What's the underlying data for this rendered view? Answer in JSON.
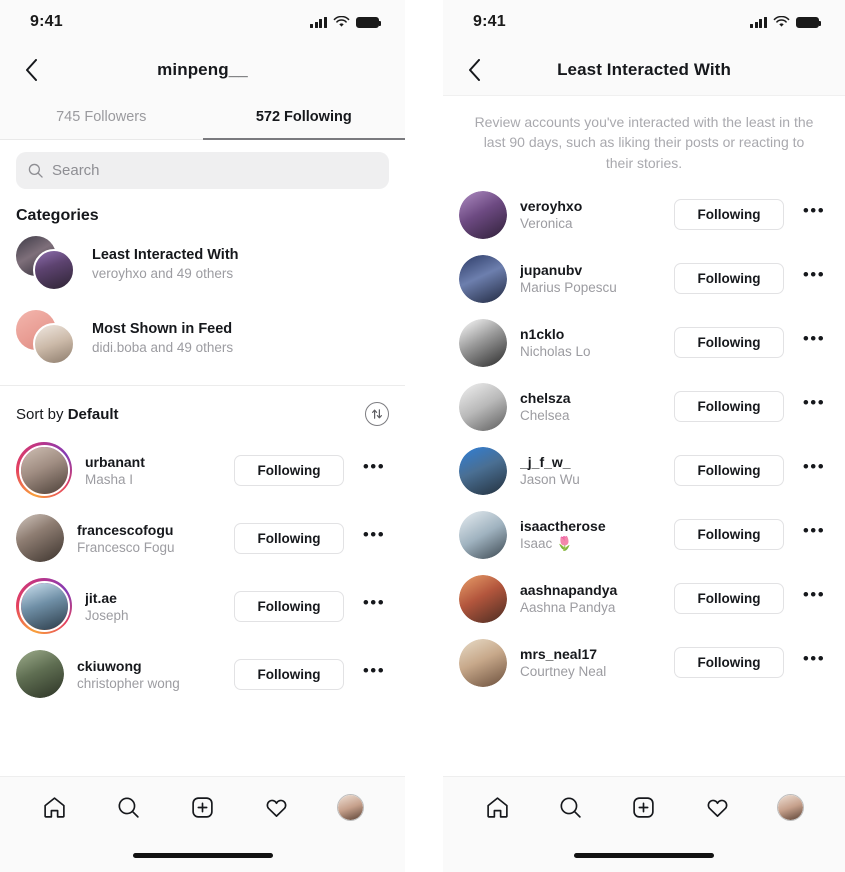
{
  "status_bar": {
    "time": "9:41",
    "signal_icon": "cellular-bars-icon",
    "wifi_icon": "wifi-icon",
    "battery_icon": "battery-full-icon"
  },
  "left_panel": {
    "nav": {
      "back_icon": "chevron-left-icon",
      "title": "minpeng__"
    },
    "tabs": [
      {
        "label": "745 Followers",
        "active": false
      },
      {
        "label": "572 Following",
        "active": true
      }
    ],
    "search": {
      "placeholder": "Search",
      "value": "",
      "icon": "search-icon"
    },
    "categories_title": "Categories",
    "categories": [
      {
        "name": "Least Interacted With",
        "subtitle": "veroyhxo and 49 others"
      },
      {
        "name": "Most Shown in Feed",
        "subtitle": "didi.boba and 49 others"
      }
    ],
    "sort": {
      "prefix": "Sort by",
      "value": "Default",
      "icon": "sort-updown-icon"
    },
    "users": [
      {
        "username": "urbanant",
        "fullname": "Masha I",
        "button": "Following",
        "story_ring": true,
        "more_icon": "more-horizontal-icon"
      },
      {
        "username": "francescofogu",
        "fullname": "Francesco Fogu",
        "button": "Following",
        "story_ring": false,
        "more_icon": "more-horizontal-icon"
      },
      {
        "username": "jit.ae",
        "fullname": "Joseph",
        "button": "Following",
        "story_ring": true,
        "more_icon": "more-horizontal-icon"
      },
      {
        "username": "ckiuwong",
        "fullname": "christopher wong",
        "button": "Following",
        "story_ring": false,
        "more_icon": "more-horizontal-icon"
      }
    ]
  },
  "right_panel": {
    "nav": {
      "back_icon": "chevron-left-icon",
      "title": "Least Interacted With"
    },
    "description": "Review accounts you've interacted with the least in the last 90 days, such as liking their posts or reacting to their stories.",
    "users": [
      {
        "username": "veroyhxo",
        "fullname": "Veronica",
        "button": "Following",
        "more_icon": "more-horizontal-icon"
      },
      {
        "username": "jupanubv",
        "fullname": "Marius Popescu",
        "button": "Following",
        "more_icon": "more-horizontal-icon"
      },
      {
        "username": "n1cklo",
        "fullname": "Nicholas Lo",
        "button": "Following",
        "more_icon": "more-horizontal-icon"
      },
      {
        "username": "chelsza",
        "fullname": "Chelsea",
        "button": "Following",
        "more_icon": "more-horizontal-icon"
      },
      {
        "username": "_j_f_w_",
        "fullname": "Jason Wu",
        "button": "Following",
        "more_icon": "more-horizontal-icon"
      },
      {
        "username": "isaactherose",
        "fullname": "Isaac 🌷",
        "button": "Following",
        "more_icon": "more-horizontal-icon"
      },
      {
        "username": "aashnapandya",
        "fullname": "Aashna Pandya",
        "button": "Following",
        "more_icon": "more-horizontal-icon"
      },
      {
        "username": "mrs_neal17",
        "fullname": "Courtney Neal",
        "button": "Following",
        "more_icon": "more-horizontal-icon"
      }
    ]
  },
  "tabbar": {
    "items": [
      {
        "icon": "home-icon",
        "label": "Home"
      },
      {
        "icon": "search-icon",
        "label": "Search"
      },
      {
        "icon": "add-post-icon",
        "label": "Create"
      },
      {
        "icon": "heart-icon",
        "label": "Activity"
      },
      {
        "icon": "profile-avatar-icon",
        "label": "Profile"
      }
    ]
  },
  "colors": {
    "accent": "#16181c",
    "muted": "#9c9ca1",
    "button_border": "#e2e2e4",
    "search_bg": "#efeff0"
  }
}
